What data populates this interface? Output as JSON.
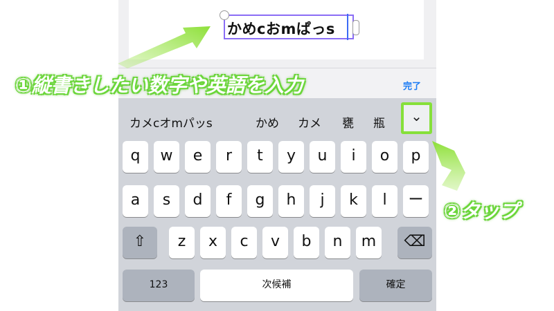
{
  "canvas": {
    "text": "かめcおmぱっs"
  },
  "toolbar": {
    "done_label": "完了"
  },
  "candidates": [
    "カメcオmパッs",
    "かめ",
    "カメ",
    "甕",
    "瓶"
  ],
  "expand_icon": "chevron-down-icon",
  "keyboard": {
    "row1": [
      "q",
      "w",
      "e",
      "r",
      "t",
      "y",
      "u",
      "i",
      "o",
      "p"
    ],
    "row2": [
      "a",
      "s",
      "d",
      "f",
      "g",
      "h",
      "j",
      "k",
      "l",
      "ー"
    ],
    "row3": [
      "z",
      "x",
      "c",
      "v",
      "b",
      "n",
      "m"
    ],
    "shift_icon": "⇧",
    "delete_icon": "⌫",
    "numbers_label": "123",
    "next_label": "次候補",
    "confirm_label": "確定"
  },
  "annotations": {
    "step1": "①縦書きしたい数字や英語を入力",
    "step2": "②タップ"
  },
  "colors": {
    "accent_green": "#86e03a",
    "selection_purple": "#8a6df5",
    "link_blue": "#1c7cf4"
  }
}
